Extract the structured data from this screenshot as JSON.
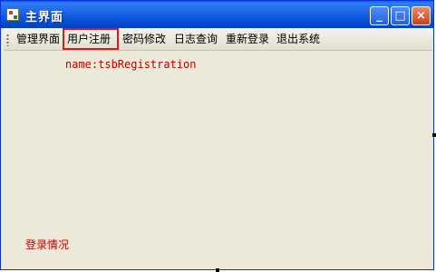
{
  "window": {
    "title": "主界面"
  },
  "caption_buttons": {
    "minimize": "_",
    "maximize": "□",
    "close": "×"
  },
  "toolbar": {
    "items": [
      {
        "label": "管理界面"
      },
      {
        "label": "用户注册"
      },
      {
        "label": "密码修改"
      },
      {
        "label": "日志查询"
      },
      {
        "label": "重新登录"
      },
      {
        "label": "退出系统"
      }
    ]
  },
  "content": {
    "name_label": "name:tsbRegistration",
    "status_label": "登录情况"
  },
  "colors": {
    "highlight_border": "#e01818",
    "label_text": "#c00000",
    "titlebar": "#0553d6",
    "background": "#ece9d8"
  },
  "icons": {
    "app": "app-icon",
    "minimize": "minimize-icon",
    "maximize": "maximize-icon",
    "close": "close-icon"
  }
}
